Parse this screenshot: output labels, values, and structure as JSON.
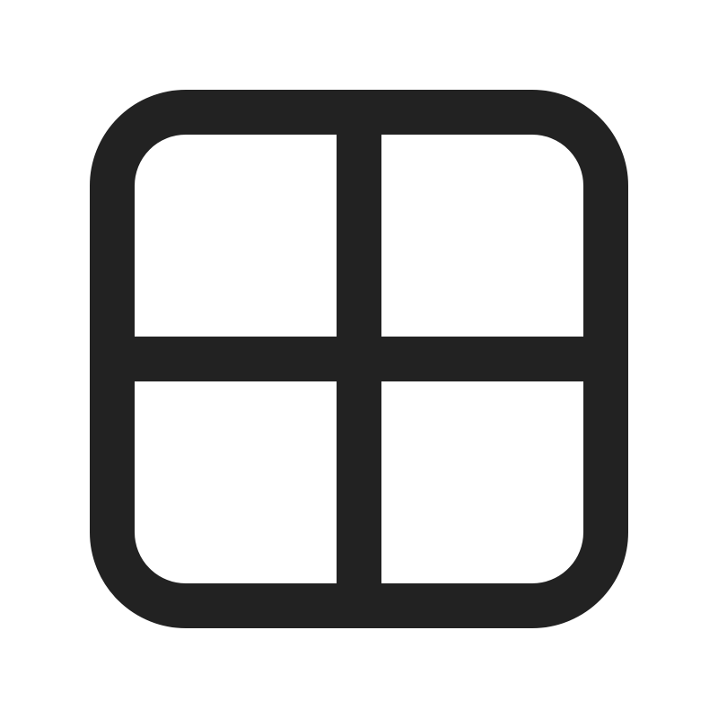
{
  "icon": {
    "name": "grid-icon",
    "stroke_color": "#222222",
    "background_color": "#ffffff"
  }
}
